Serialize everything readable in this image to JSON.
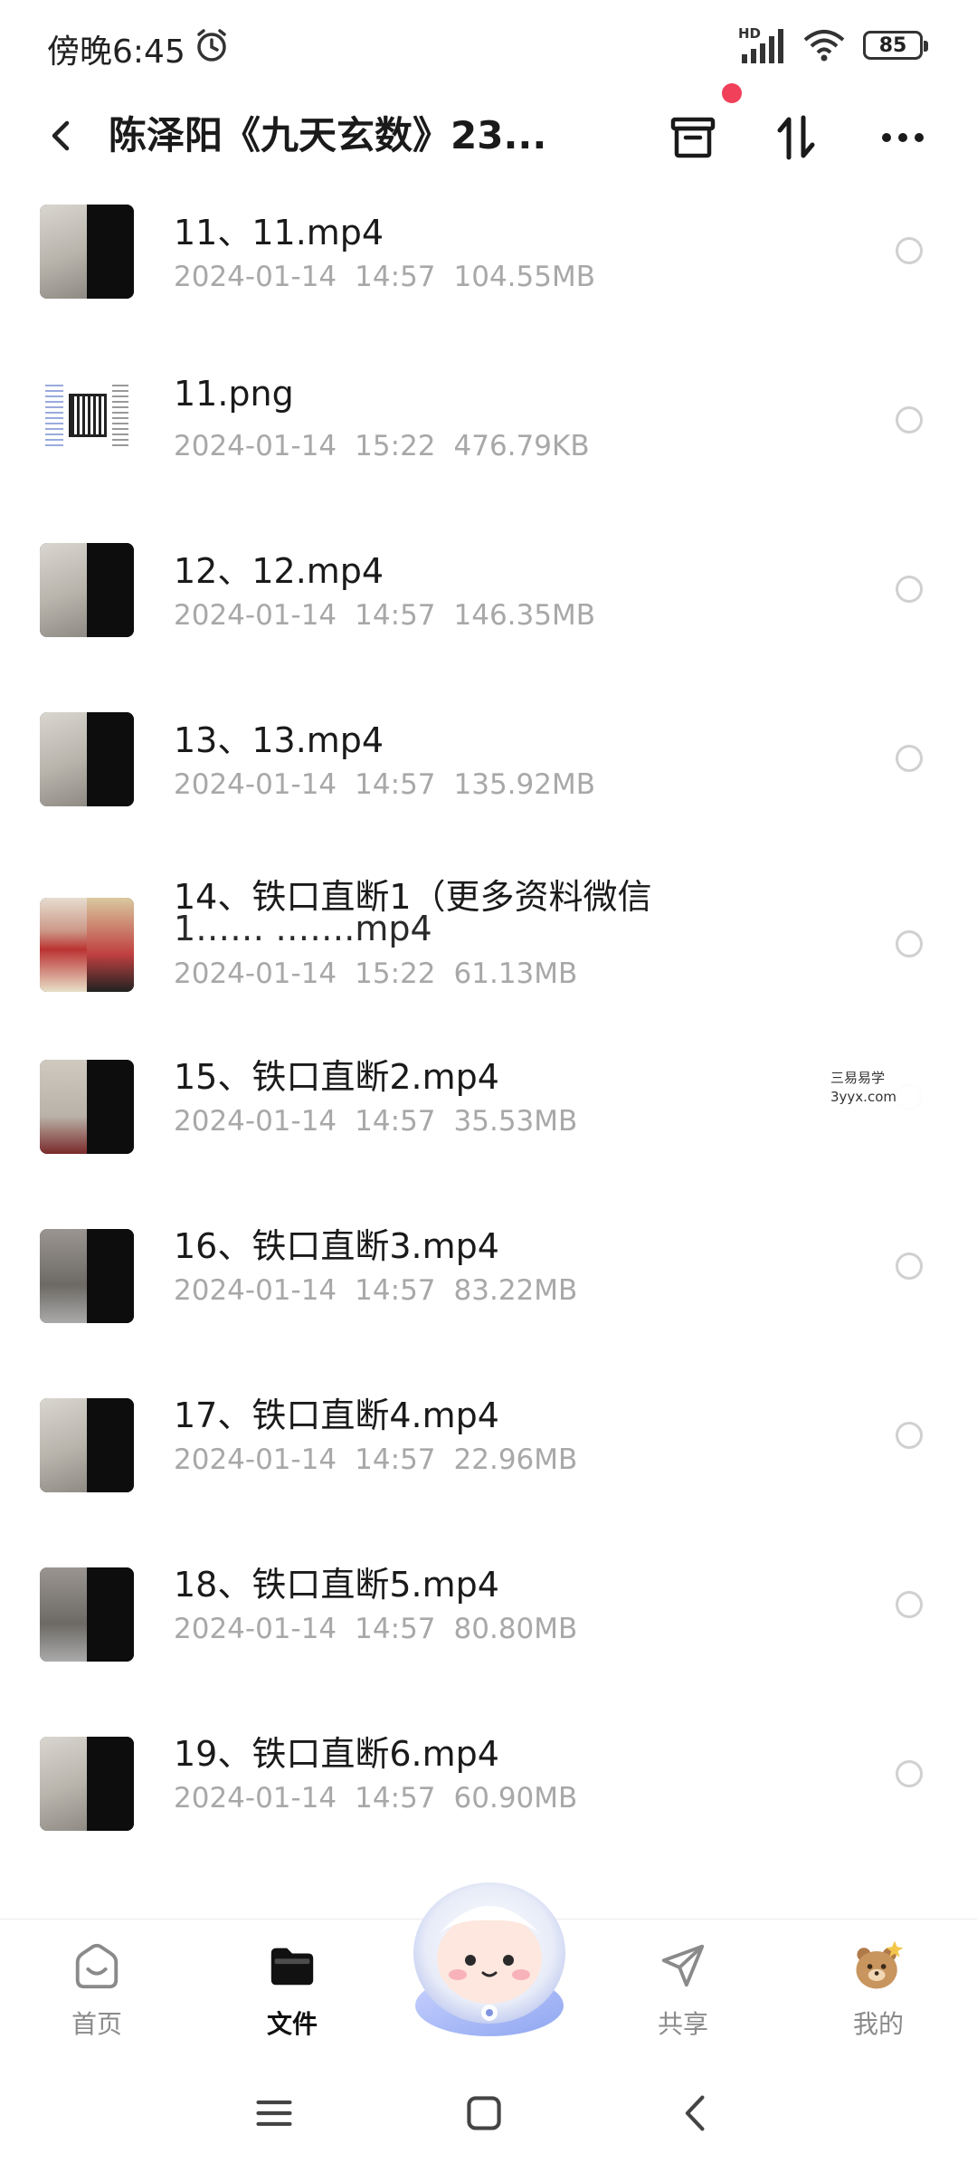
{
  "status_bar": {
    "time": "傍晚6:45",
    "network_label": "HD",
    "battery": "85"
  },
  "header": {
    "title": "陈泽阳《九天玄数》23...",
    "back_icon": "chevron-left-icon",
    "archive_icon": "archive-icon",
    "sort_icon": "sort-icon",
    "more_icon": "more-icon",
    "notification_color": "#f0405a"
  },
  "files": [
    {
      "name": "11、11.mp4",
      "date": "2024-01-14",
      "time": "14:57",
      "size": "104.55MB",
      "thumb": "video"
    },
    {
      "name": "11.png",
      "date": "2024-01-14",
      "time": "15:22",
      "size": "476.79KB",
      "thumb": "png"
    },
    {
      "name": "12、12.mp4",
      "date": "2024-01-14",
      "time": "14:57",
      "size": "146.35MB",
      "thumb": "video"
    },
    {
      "name": "13、13.mp4",
      "date": "2024-01-14",
      "time": "14:57",
      "size": "135.92MB",
      "thumb": "video"
    },
    {
      "name": "14、铁口直断1（更多资料微信",
      "name_line2": "1…… …….mp4",
      "date": "2024-01-14",
      "time": "15:22",
      "size": "61.13MB",
      "thumb": "colorful"
    },
    {
      "name": "15、铁口直断2.mp4",
      "date": "2024-01-14",
      "time": "14:57",
      "size": "35.53MB",
      "thumb": "reddish"
    },
    {
      "name": "16、铁口直断3.mp4",
      "date": "2024-01-14",
      "time": "14:57",
      "size": "83.22MB",
      "thumb": "blurry"
    },
    {
      "name": "17、铁口直断4.mp4",
      "date": "2024-01-14",
      "time": "14:57",
      "size": "22.96MB",
      "thumb": "video"
    },
    {
      "name": "18、铁口直断5.mp4",
      "date": "2024-01-14",
      "time": "14:57",
      "size": "80.80MB",
      "thumb": "blurry"
    },
    {
      "name": "19、铁口直断6.mp4",
      "date": "2024-01-14",
      "time": "14:57",
      "size": "60.90MB",
      "thumb": "video"
    }
  ],
  "watermark": {
    "line1": "三易易学",
    "line2": "3yyx.com"
  },
  "bottom_nav": [
    {
      "label": "首页",
      "icon": "home-icon",
      "active": false
    },
    {
      "label": "文件",
      "icon": "folder-icon",
      "active": true
    },
    {
      "label": "",
      "icon": "mascot-icon",
      "active": false
    },
    {
      "label": "共享",
      "icon": "send-icon",
      "active": false
    },
    {
      "label": "我的",
      "icon": "profile-avatar-icon",
      "active": false
    }
  ]
}
